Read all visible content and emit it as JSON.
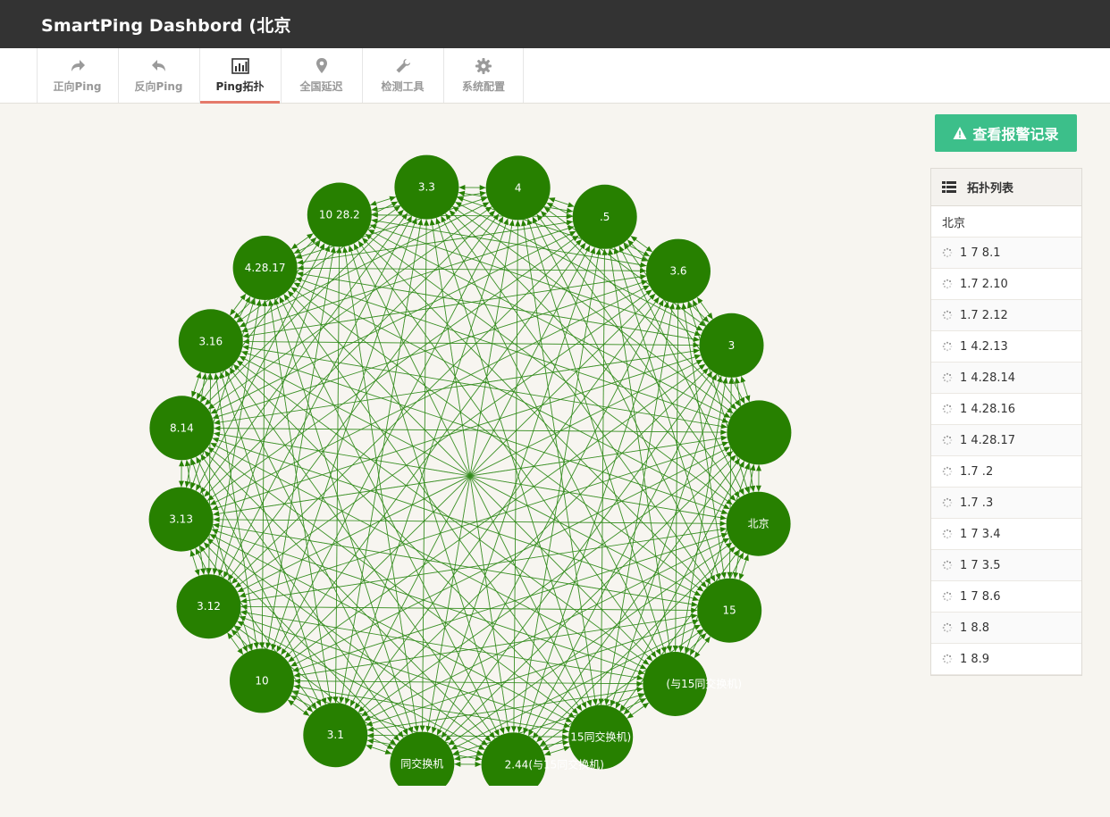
{
  "app": {
    "title": "SmartPing Dashbord (北京"
  },
  "nav": {
    "tabs": [
      {
        "label": "正向Ping",
        "icon": "forward-arrow-icon"
      },
      {
        "label": "反向Ping",
        "icon": "reply-arrow-icon"
      },
      {
        "label": "Ping拓扑",
        "icon": "bar-chart-icon",
        "active": true
      },
      {
        "label": "全国延迟",
        "icon": "map-pin-icon"
      },
      {
        "label": "检测工具",
        "icon": "wrench-icon"
      },
      {
        "label": "系统配置",
        "icon": "gear-icon"
      }
    ]
  },
  "alarm": {
    "label": "查看报警记录",
    "icon": "warning-icon"
  },
  "topo_list": {
    "title": "拓扑列表",
    "icon": "list-icon",
    "root": "北京",
    "items": [
      "1 7 8.1",
      "1.7 2.10",
      "1.7 2.12",
      "1 4.2.13",
      "1 4.28.14",
      "1 4.28.16",
      "1 4.28.17",
      "1.7 .2",
      "1.7 .3",
      "1 7 3.4",
      "1 7 3.5",
      "1 7 8.6",
      "1 8.8",
      "1 8.9"
    ]
  },
  "topology": {
    "colors": {
      "node": "#278000",
      "edge": "#2f8a18",
      "label": "#ffffff"
    },
    "nodes": [
      {
        "label": "3.3"
      },
      {
        "label": "4"
      },
      {
        "label": ".5"
      },
      {
        "label": "3.6"
      },
      {
        "label": "3"
      },
      {
        "label": ""
      },
      {
        "label": "北京"
      },
      {
        "label": "15"
      },
      {
        "label": "(与15同交换机)"
      },
      {
        "label": "15同交换机)"
      },
      {
        "label": "2.44(与15同交换机)"
      },
      {
        "label": "同交换机"
      },
      {
        "label": "3.1"
      },
      {
        "label": "10"
      },
      {
        "label": "3.12"
      },
      {
        "label": "3.13"
      },
      {
        "label": "8.14"
      },
      {
        "label": "3.16"
      },
      {
        "label": "4.28.17"
      },
      {
        "label": "10 28.2"
      }
    ]
  }
}
